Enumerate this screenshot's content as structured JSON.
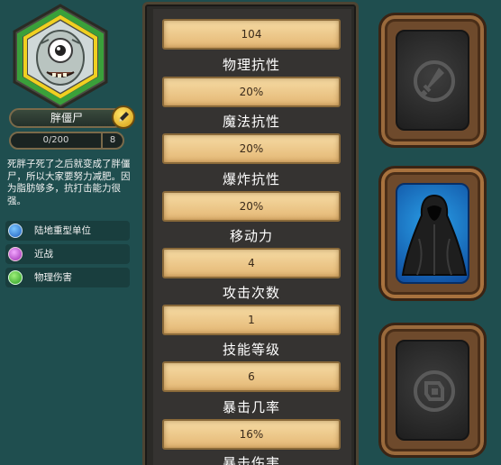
{
  "hero": {
    "name": "胖僵尸",
    "exp_text": "0/200",
    "exp_fraction": 0,
    "level": "8",
    "description": "死胖子死了之后就变成了胖僵尸，所以大家要努力减肥。因为脂肪够多，抗打击能力很强。"
  },
  "tags": [
    {
      "label": "陆地重型单位",
      "icon": "person-icon"
    },
    {
      "label": "近战",
      "icon": "target-icon"
    },
    {
      "label": "物理伤害",
      "icon": "sword-icon"
    }
  ],
  "stats": [
    {
      "value": "104",
      "label": "物理抗性"
    },
    {
      "value": "20%",
      "label": "魔法抗性"
    },
    {
      "value": "20%",
      "label": "爆炸抗性"
    },
    {
      "value": "20%",
      "label": "移动力"
    },
    {
      "value": "4",
      "label": "攻击次数"
    },
    {
      "value": "1",
      "label": "技能等级"
    },
    {
      "value": "6",
      "label": "暴击几率"
    },
    {
      "value": "16%",
      "label": "暴击伤害"
    }
  ],
  "equipment": [
    {
      "state": "empty",
      "icon": "weapon-slot-icon"
    },
    {
      "state": "equipped",
      "icon": "black-cloak-icon"
    },
    {
      "state": "empty",
      "icon": "accessory-slot-icon"
    }
  ],
  "colors": {
    "background": "#1f4e4f",
    "stat_bar": "#f0cf92",
    "slot_frame": "#6e4a2c",
    "equipped_slot": "#1a78cc",
    "portrait_ring_yellow": "#f0d020",
    "portrait_ring_green": "#3aa03a"
  }
}
